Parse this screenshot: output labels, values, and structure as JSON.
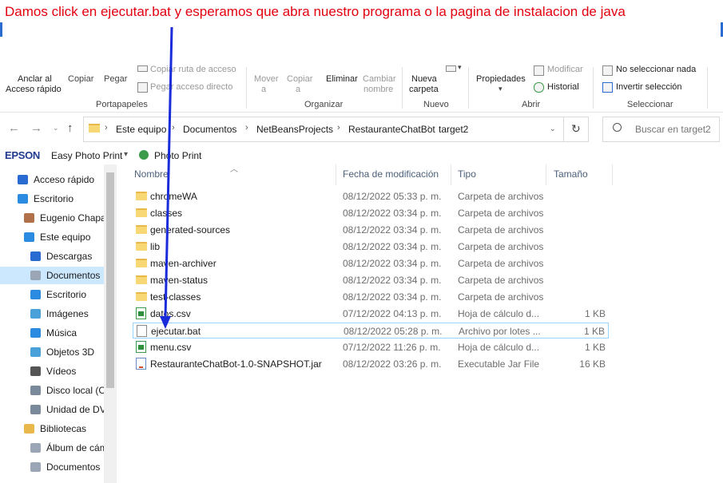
{
  "annotation": {
    "text": "Damos click en ejecutar.bat y esperamos que abra nuestro programa o la pagina de instalacion de java",
    "color": "#e3000f",
    "arrow_color": "#1a2bd9"
  },
  "ribbon": {
    "clipboard": {
      "pin_label": "Anclar al",
      "pin_label2": "Acceso rápido",
      "copy_label": "Copiar",
      "paste_label": "Pegar",
      "copy_path_label": "Copiar ruta de acceso",
      "paste_shortcut_label": "Pegar acceso directo",
      "group_label": "Portapapeles"
    },
    "organize": {
      "move_label": "Mover",
      "move_sub": "a",
      "copy_to_label": "Copiar",
      "copy_to_sub": "a",
      "delete_label": "Eliminar",
      "rename_label": "Cambiar",
      "rename_label2": "nombre",
      "group_label": "Organizar"
    },
    "new": {
      "new_folder_label": "Nueva",
      "new_folder_label2": "carpeta",
      "group_label": "Nuevo"
    },
    "open": {
      "properties_label": "Propiedades",
      "edit_label": "Modificar",
      "history_label": "Historial",
      "group_label": "Abrir"
    },
    "select": {
      "select_none_label": "No seleccionar nada",
      "invert_label": "Invertir selección",
      "group_label": "Seleccionar"
    }
  },
  "address": {
    "crumbs": [
      "Este equipo",
      "Documentos",
      "NetBeansProjects",
      "RestauranteChatBot",
      "target2"
    ],
    "search_placeholder": "Buscar en target2"
  },
  "epson_toolbar": {
    "brand": "EPSON",
    "app": "Easy Photo Print",
    "photo_print": "Photo Print"
  },
  "nav": {
    "items": [
      {
        "label": "Acceso rápido",
        "icon": "star-icon"
      },
      {
        "label": "Escritorio",
        "icon": "desktop-icon"
      },
      {
        "label": "Eugenio Chapa",
        "icon": "user-icon"
      },
      {
        "label": "Este equipo",
        "icon": "computer-icon"
      },
      {
        "label": "Descargas",
        "icon": "download-icon"
      },
      {
        "label": "Documentos",
        "icon": "documents-icon"
      },
      {
        "label": "Escritorio",
        "icon": "desktop-icon"
      },
      {
        "label": "Imágenes",
        "icon": "pictures-icon"
      },
      {
        "label": "Música",
        "icon": "music-icon"
      },
      {
        "label": "Objetos 3D",
        "icon": "3d-objects-icon"
      },
      {
        "label": "Vídeos",
        "icon": "videos-icon"
      },
      {
        "label": "Disco local (C:)",
        "icon": "drive-icon"
      },
      {
        "label": "Unidad de DVD",
        "icon": "dvd-icon"
      },
      {
        "label": "Bibliotecas",
        "icon": "libraries-icon"
      },
      {
        "label": "Álbum de cámara",
        "icon": "camera-roll-icon"
      },
      {
        "label": "Documentos",
        "icon": "documents-icon"
      }
    ],
    "selected_index": 5
  },
  "columns": {
    "name": "Nombre",
    "date": "Fecha de modificación",
    "type": "Tipo",
    "size": "Tamaño"
  },
  "files": [
    {
      "name": "chromeWA",
      "date": "08/12/2022 05:33 p. m.",
      "type": "Carpeta de archivos",
      "size": "",
      "kind": "folder"
    },
    {
      "name": "classes",
      "date": "08/12/2022 03:34 p. m.",
      "type": "Carpeta de archivos",
      "size": "",
      "kind": "folder"
    },
    {
      "name": "generated-sources",
      "date": "08/12/2022 03:34 p. m.",
      "type": "Carpeta de archivos",
      "size": "",
      "kind": "folder"
    },
    {
      "name": "lib",
      "date": "08/12/2022 03:34 p. m.",
      "type": "Carpeta de archivos",
      "size": "",
      "kind": "folder"
    },
    {
      "name": "maven-archiver",
      "date": "08/12/2022 03:34 p. m.",
      "type": "Carpeta de archivos",
      "size": "",
      "kind": "folder"
    },
    {
      "name": "maven-status",
      "date": "08/12/2022 03:34 p. m.",
      "type": "Carpeta de archivos",
      "size": "",
      "kind": "folder"
    },
    {
      "name": "test-classes",
      "date": "08/12/2022 03:34 p. m.",
      "type": "Carpeta de archivos",
      "size": "",
      "kind": "folder"
    },
    {
      "name": "datos.csv",
      "date": "07/12/2022 04:13 p. m.",
      "type": "Hoja de cálculo d...",
      "size": "1 KB",
      "kind": "csv"
    },
    {
      "name": "ejecutar.bat",
      "date": "08/12/2022 05:28 p. m.",
      "type": "Archivo por lotes ...",
      "size": "1 KB",
      "kind": "bat",
      "selected": true
    },
    {
      "name": "menu.csv",
      "date": "07/12/2022 11:26 p. m.",
      "type": "Hoja de cálculo d...",
      "size": "1 KB",
      "kind": "csv"
    },
    {
      "name": "RestauranteChatBot-1.0-SNAPSHOT.jar",
      "date": "08/12/2022 03:26 p. m.",
      "type": "Executable Jar File",
      "size": "16 KB",
      "kind": "jar"
    }
  ]
}
